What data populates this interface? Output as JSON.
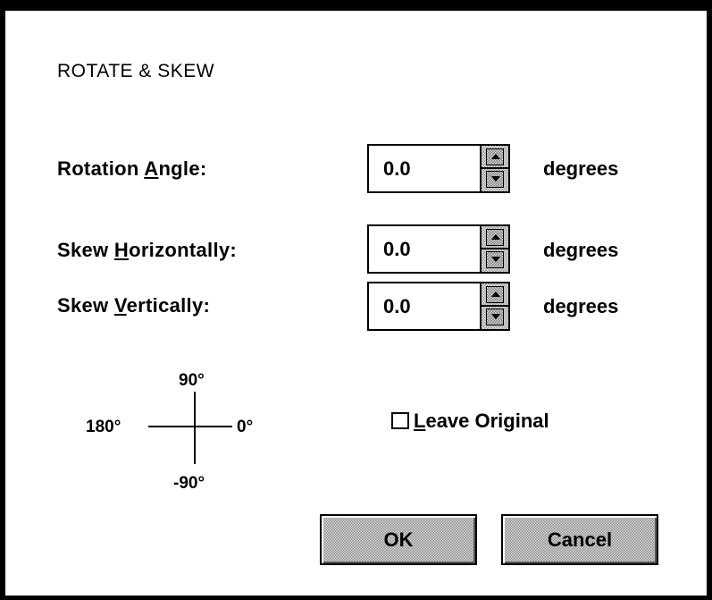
{
  "dialog": {
    "title": "ROTATE & SKEW"
  },
  "rotation": {
    "label_pre": "Rot",
    "label_mid": "a",
    "label_post": "tion ",
    "label_acc": "A",
    "label_rest": "ngle:",
    "value": "0.0",
    "unit": "degrees"
  },
  "skew_h": {
    "label_pre": "Skew ",
    "label_acc": "H",
    "label_rest": "orizontally:",
    "value": "0.0",
    "unit": "degrees"
  },
  "skew_v": {
    "label_pre": "Skew ",
    "label_acc": "V",
    "label_rest": "ertically:",
    "value": "0.0",
    "unit": "degrees"
  },
  "compass": {
    "top": "90°",
    "left": "180°",
    "right": "0°",
    "bottom": "-90°"
  },
  "leave_original": {
    "acc": "L",
    "rest": "eave Original",
    "checked": false
  },
  "buttons": {
    "ok": "OK",
    "cancel": "Cancel"
  }
}
